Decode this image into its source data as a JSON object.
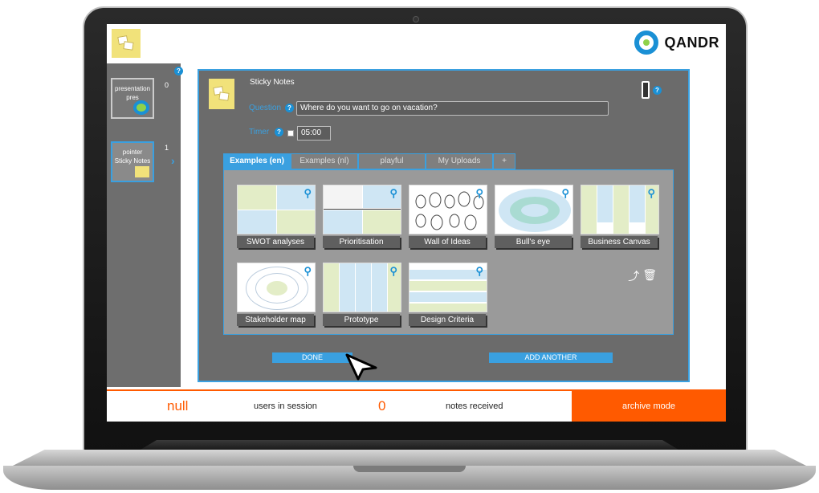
{
  "header": {
    "brand": "QANDR",
    "brand_icon": "qandr-logo-icon",
    "logo_icon": "sticky-notes-icon"
  },
  "sidebar": {
    "help_icon": "question-icon",
    "slides": [
      {
        "number": "0",
        "title": "presentation pres",
        "thumbnail": "qandr-ring-icon"
      },
      {
        "number": "1",
        "title": "pointer",
        "subtitle": "Sticky Notes",
        "thumbnail": "sticky-notes-icon",
        "selected": true
      }
    ]
  },
  "editor": {
    "title": "Sticky Notes",
    "question_label": "Question",
    "question_value": "Where do you want to go on vacation?",
    "timer_label": "Timer",
    "timer_value": "05:00",
    "tabs": [
      "Examples (en)",
      "Examples (nl)",
      "playful",
      "My Uploads",
      "+"
    ],
    "active_tab": "Examples (en)",
    "templates": [
      {
        "name": "SWOT analyses"
      },
      {
        "name": "Prioritisation"
      },
      {
        "name": "Wall of Ideas"
      },
      {
        "name": "Bull's eye"
      },
      {
        "name": "Business Canvas"
      },
      {
        "name": "Stakeholder map"
      },
      {
        "name": "Prototype"
      },
      {
        "name": "Design Criteria"
      }
    ],
    "done_label": "DONE",
    "add_another_label": "ADD ANOTHER"
  },
  "footer": {
    "users_count": "null",
    "users_label": "users in session",
    "notes_count": "0",
    "notes_label": "notes received",
    "mode": "archive mode"
  },
  "colors": {
    "accent": "#3aa0e0",
    "orange": "#ff5a00",
    "sticky": "#f1e27a",
    "panel": "#6b6b6b"
  }
}
